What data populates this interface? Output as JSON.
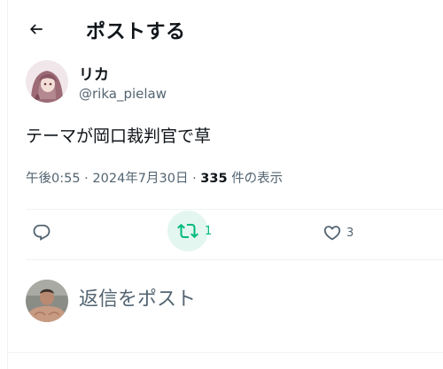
{
  "header": {
    "title": "ポストする",
    "back_icon": "arrow-left-icon"
  },
  "post": {
    "author": {
      "display_name": "リカ",
      "handle": "@rika_pielaw",
      "avatar": "anime-girl-avatar"
    },
    "text": "テーマが岡口裁判官で草",
    "timestamp": "午後0:55 · 2024年7月30日",
    "meta_separator": "·",
    "view_count": "335",
    "view_label": "件の表示"
  },
  "actions": {
    "reply": {
      "icon": "reply-icon",
      "count": ""
    },
    "repost": {
      "icon": "repost-icon",
      "count": "1",
      "active": true,
      "color": "#00ba7c"
    },
    "like": {
      "icon": "heart-icon",
      "count": "3"
    }
  },
  "reply_box": {
    "placeholder": "返信をポスト",
    "avatar": "user-avatar"
  },
  "colors": {
    "text": "#0f1419",
    "secondary": "#536471",
    "divider": "#eff3f4",
    "repost_green": "#00ba7c",
    "repost_bg": "#e3f6ef"
  }
}
